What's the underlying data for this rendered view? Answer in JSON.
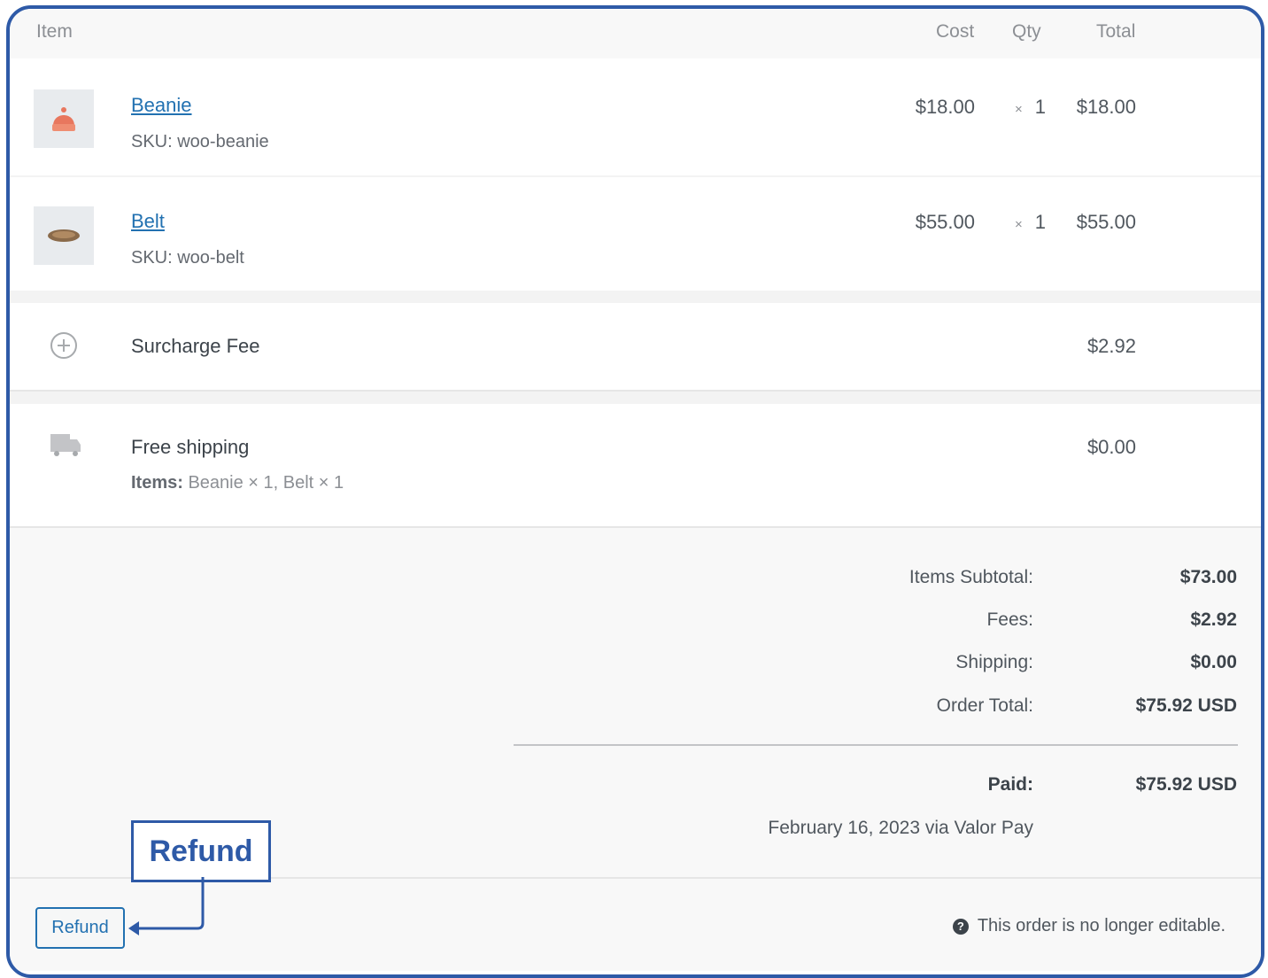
{
  "header": {
    "item": "Item",
    "cost": "Cost",
    "qty": "Qty",
    "total": "Total"
  },
  "line_items": [
    {
      "name": "Beanie",
      "sku": "SKU: woo-beanie",
      "cost": "$18.00",
      "qty_prefix": "×",
      "qty": "1",
      "total": "$18.00",
      "icon": "beanie-thumbnail",
      "icon_color": "#e8775e"
    },
    {
      "name": "Belt",
      "sku": "SKU: woo-belt",
      "cost": "$55.00",
      "qty_prefix": "×",
      "qty": "1",
      "total": "$55.00",
      "icon": "belt-thumbnail",
      "icon_color": "#8a6a4a"
    }
  ],
  "fee": {
    "label": "Surcharge Fee",
    "total": "$2.92",
    "icon": "plus-circle-icon"
  },
  "shipping": {
    "label": "Free shipping",
    "items_label": "Items:",
    "items_value": "Beanie × 1, Belt × 1",
    "total": "$0.00",
    "icon": "truck-icon"
  },
  "totals": {
    "items_subtotal_label": "Items Subtotal:",
    "items_subtotal": "$73.00",
    "fees_label": "Fees:",
    "fees": "$2.92",
    "shipping_label": "Shipping:",
    "shipping": "$0.00",
    "order_total_label": "Order Total:",
    "order_total": "$75.92 USD",
    "paid_label": "Paid:",
    "paid": "$75.92 USD",
    "paid_note": "February 16, 2023 via Valor Pay"
  },
  "actions": {
    "refund_button": "Refund",
    "callout": "Refund",
    "not_editable": "This order is no longer editable."
  },
  "colors": {
    "accent": "#2e5aa7",
    "link": "#2271b1"
  }
}
